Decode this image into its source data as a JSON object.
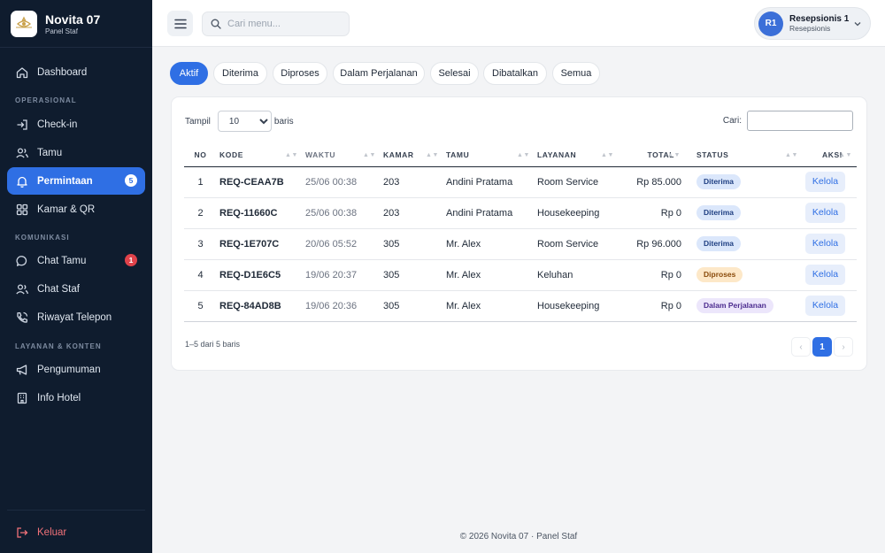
{
  "brand": {
    "name": "Novita 07",
    "subtitle": "Panel Staf"
  },
  "sidebar": {
    "items": [
      {
        "label": "Dashboard",
        "icon": "home-icon"
      },
      {
        "label": "Check-in",
        "icon": "login-icon"
      },
      {
        "label": "Tamu",
        "icon": "users-icon"
      },
      {
        "label": "Permintaan",
        "icon": "bell-icon",
        "badge": "5",
        "active": true
      },
      {
        "label": "Kamar & QR",
        "icon": "grid-icon"
      },
      {
        "label": "Chat Tamu",
        "icon": "chat-icon",
        "badge": "1"
      },
      {
        "label": "Chat Staf",
        "icon": "users-icon"
      },
      {
        "label": "Riwayat Telepon",
        "icon": "phone-icon"
      },
      {
        "label": "Pengumuman",
        "icon": "megaphone-icon"
      },
      {
        "label": "Info Hotel",
        "icon": "building-icon"
      }
    ],
    "sections": [
      "OPERASIONAL",
      "KOMUNIKASI",
      "LAYANAN & KONTEN"
    ],
    "logout_label": "Keluar"
  },
  "topbar": {
    "search_placeholder": "Cari menu...",
    "user": {
      "initials": "R1",
      "name": "Resepsionis 1",
      "role": "Resepsionis"
    }
  },
  "filters": {
    "tabs": [
      "Aktif",
      "Diterima",
      "Diproses",
      "Dalam Perjalanan",
      "Selesai",
      "Dibatalkan",
      "Semua"
    ],
    "active": "Aktif"
  },
  "table": {
    "show_label": "Tampil",
    "show_value": "10",
    "rows_label": "baris",
    "search_label": "Cari:",
    "columns": [
      "NO",
      "KODE",
      "WAKTU",
      "KAMAR",
      "TAMU",
      "LAYANAN",
      "TOTAL",
      "STATUS",
      "AKSI"
    ],
    "rows": [
      {
        "no": "1",
        "code": "REQ-CEAA7B",
        "time": "25/06 00:38",
        "room": "203",
        "guest": "Andini Pratama",
        "service": "Room Service",
        "total": "Rp 85.000",
        "status": "Diterima",
        "action": "Kelola"
      },
      {
        "no": "2",
        "code": "REQ-11660C",
        "time": "25/06 00:38",
        "room": "203",
        "guest": "Andini Pratama",
        "service": "Housekeeping",
        "total": "Rp 0",
        "status": "Diterima",
        "action": "Kelola"
      },
      {
        "no": "3",
        "code": "REQ-1E707C",
        "time": "20/06 05:52",
        "room": "305",
        "guest": "Mr. Alex",
        "service": "Room Service",
        "total": "Rp 96.000",
        "status": "Diterima",
        "action": "Kelola"
      },
      {
        "no": "4",
        "code": "REQ-D1E6C5",
        "time": "19/06 20:37",
        "room": "305",
        "guest": "Mr. Alex",
        "service": "Keluhan",
        "total": "Rp 0",
        "status": "Diproses",
        "action": "Kelola"
      },
      {
        "no": "5",
        "code": "REQ-84AD8B",
        "time": "19/06 20:36",
        "room": "305",
        "guest": "Mr. Alex",
        "service": "Housekeeping",
        "total": "Rp 0",
        "status": "Dalam Perjalanan",
        "action": "Kelola"
      }
    ],
    "info": "1–5 dari 5 baris",
    "pagination": {
      "prev": "‹",
      "current": "1",
      "next": "›"
    }
  },
  "status_colors": {
    "Diterima": {
      "bg": "#dbe7fb",
      "fg": "#1f3f82"
    },
    "Diproses": {
      "bg": "#fde8c8",
      "fg": "#8a4b0b"
    },
    "Dalam Perjalanan": {
      "bg": "#ece6fb",
      "fg": "#4c2c8f"
    }
  },
  "footer": "© 2026 Novita 07 · Panel Staf"
}
